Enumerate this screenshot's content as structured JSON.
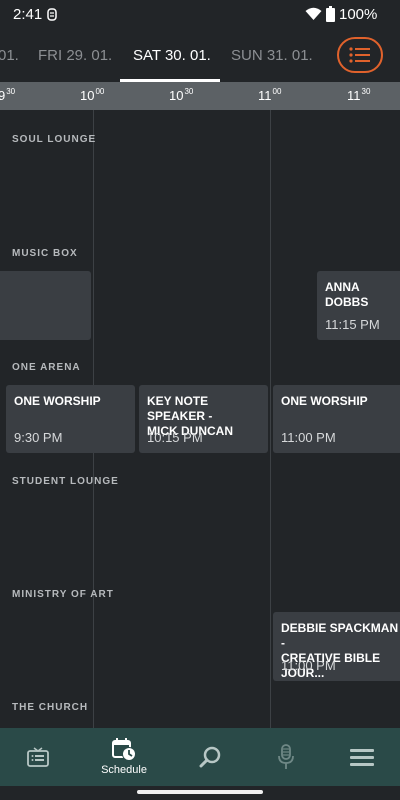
{
  "status_bar": {
    "time": "2:41",
    "battery": "100%"
  },
  "day_tabs": [
    {
      "label": "01."
    },
    {
      "label": "FRI 29. 01."
    },
    {
      "label": "SAT 30. 01.",
      "active": true
    },
    {
      "label": "SUN 31. 01."
    }
  ],
  "time_ruler": [
    {
      "hour": "9",
      "min": "30"
    },
    {
      "hour": "10",
      "min": "00"
    },
    {
      "hour": "10",
      "min": "30"
    },
    {
      "hour": "11",
      "min": "00"
    },
    {
      "hour": "11",
      "min": "30"
    }
  ],
  "rooms": [
    {
      "name": "SOUL LOUNGE"
    },
    {
      "name": "MUSIC BOX"
    },
    {
      "name": "ONE ARENA"
    },
    {
      "name": "STUDENT LOUNGE"
    },
    {
      "name": "MINISTRY OF ART"
    },
    {
      "name": "THE CHURCH"
    }
  ],
  "events": [
    {
      "title": "",
      "time": ""
    },
    {
      "title": "ANNA\nDOBBS",
      "time": "11:15 PM"
    },
    {
      "title": "ONE WORSHIP",
      "time": "9:30 PM"
    },
    {
      "title": "KEY NOTE SPEAKER -\nMICK DUNCAN",
      "time": "10:15 PM"
    },
    {
      "title": "ONE WORSHIP",
      "time": "11:00 PM"
    },
    {
      "title": "DEBBIE SPACKMAN -\nCREATIVE BIBLE JOUR...",
      "time": "11:00 PM"
    }
  ],
  "bottom_nav": [
    {
      "icon": "news-icon",
      "label": ""
    },
    {
      "icon": "schedule-icon",
      "label": "Schedule",
      "active": true
    },
    {
      "icon": "search-icon",
      "label": ""
    },
    {
      "icon": "microphone-icon",
      "label": ""
    },
    {
      "icon": "menu-icon",
      "label": ""
    }
  ],
  "colors": {
    "background": "#222528",
    "event_card": "#3a3e43",
    "ruler": "#5c6165",
    "bottom_nav": "#2a4a48",
    "accent": "#e0622c"
  }
}
